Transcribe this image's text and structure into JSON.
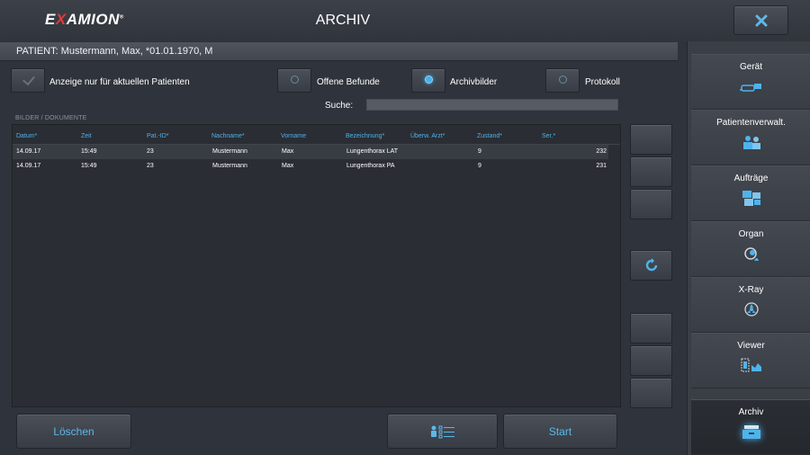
{
  "brand": {
    "logo_pre": "E",
    "logo_x": "X",
    "logo_post": "AMION",
    "trademark": "®"
  },
  "header": {
    "title": "ARCHIV",
    "close_icon": "close-icon"
  },
  "patient_bar": {
    "text": "PATIENT: Mustermann, Max, *01.01.1970, M"
  },
  "filters": {
    "current_patient_only": {
      "label": "Anzeige nur für aktuellen Patienten",
      "checked": false
    },
    "view_modes": [
      {
        "label": "Offene Befunde",
        "selected": false
      },
      {
        "label": "Archivbilder",
        "selected": true
      },
      {
        "label": "Protokoll",
        "selected": false
      }
    ]
  },
  "search": {
    "label": "Suche:",
    "value": ""
  },
  "table": {
    "section_label": "BILDER / DOKUMENTE",
    "columns": [
      "Datum*",
      "Zeit",
      "Pat.-ID*",
      "Nachname*",
      "Vorname",
      "Bezeichnung*",
      "Überw. Arzt*",
      "Zustand*",
      "Ser.*"
    ],
    "rows": [
      {
        "datum": "14.09.17",
        "zeit": "15:49",
        "pat_id": "23",
        "nachname": "Mustermann",
        "vorname": "Max",
        "bezeichnung": "Lungenthorax LAT",
        "arzt": "",
        "zustand": "9",
        "ser": "232"
      },
      {
        "datum": "14.09.17",
        "zeit": "15:49",
        "pat_id": "23",
        "nachname": "Mustermann",
        "vorname": "Max",
        "bezeichnung": "Lungenthorax PA",
        "arzt": "",
        "zustand": "9",
        "ser": "231"
      }
    ]
  },
  "side_buttons": {
    "refresh_icon": "refresh-icon"
  },
  "bottom": {
    "delete_label": "Löschen",
    "start_label": "Start",
    "list_icon": "patient-list-icon"
  },
  "nav": {
    "items": [
      {
        "label": "Gerät",
        "icon": "device-icon",
        "active": false
      },
      {
        "label": "Patientenverwalt.",
        "icon": "patients-icon",
        "active": false
      },
      {
        "label": "Aufträge",
        "icon": "orders-icon",
        "active": false
      },
      {
        "label": "Organ",
        "icon": "organ-icon",
        "active": false
      },
      {
        "label": "X-Ray",
        "icon": "xray-icon",
        "active": false
      },
      {
        "label": "Viewer",
        "icon": "viewer-icon",
        "active": false
      },
      {
        "label": "Archiv",
        "icon": "archive-icon",
        "active": true
      }
    ]
  },
  "colors": {
    "accent": "#4fb3ea",
    "background": "#2f333b",
    "brand_red": "#e23a3a"
  }
}
